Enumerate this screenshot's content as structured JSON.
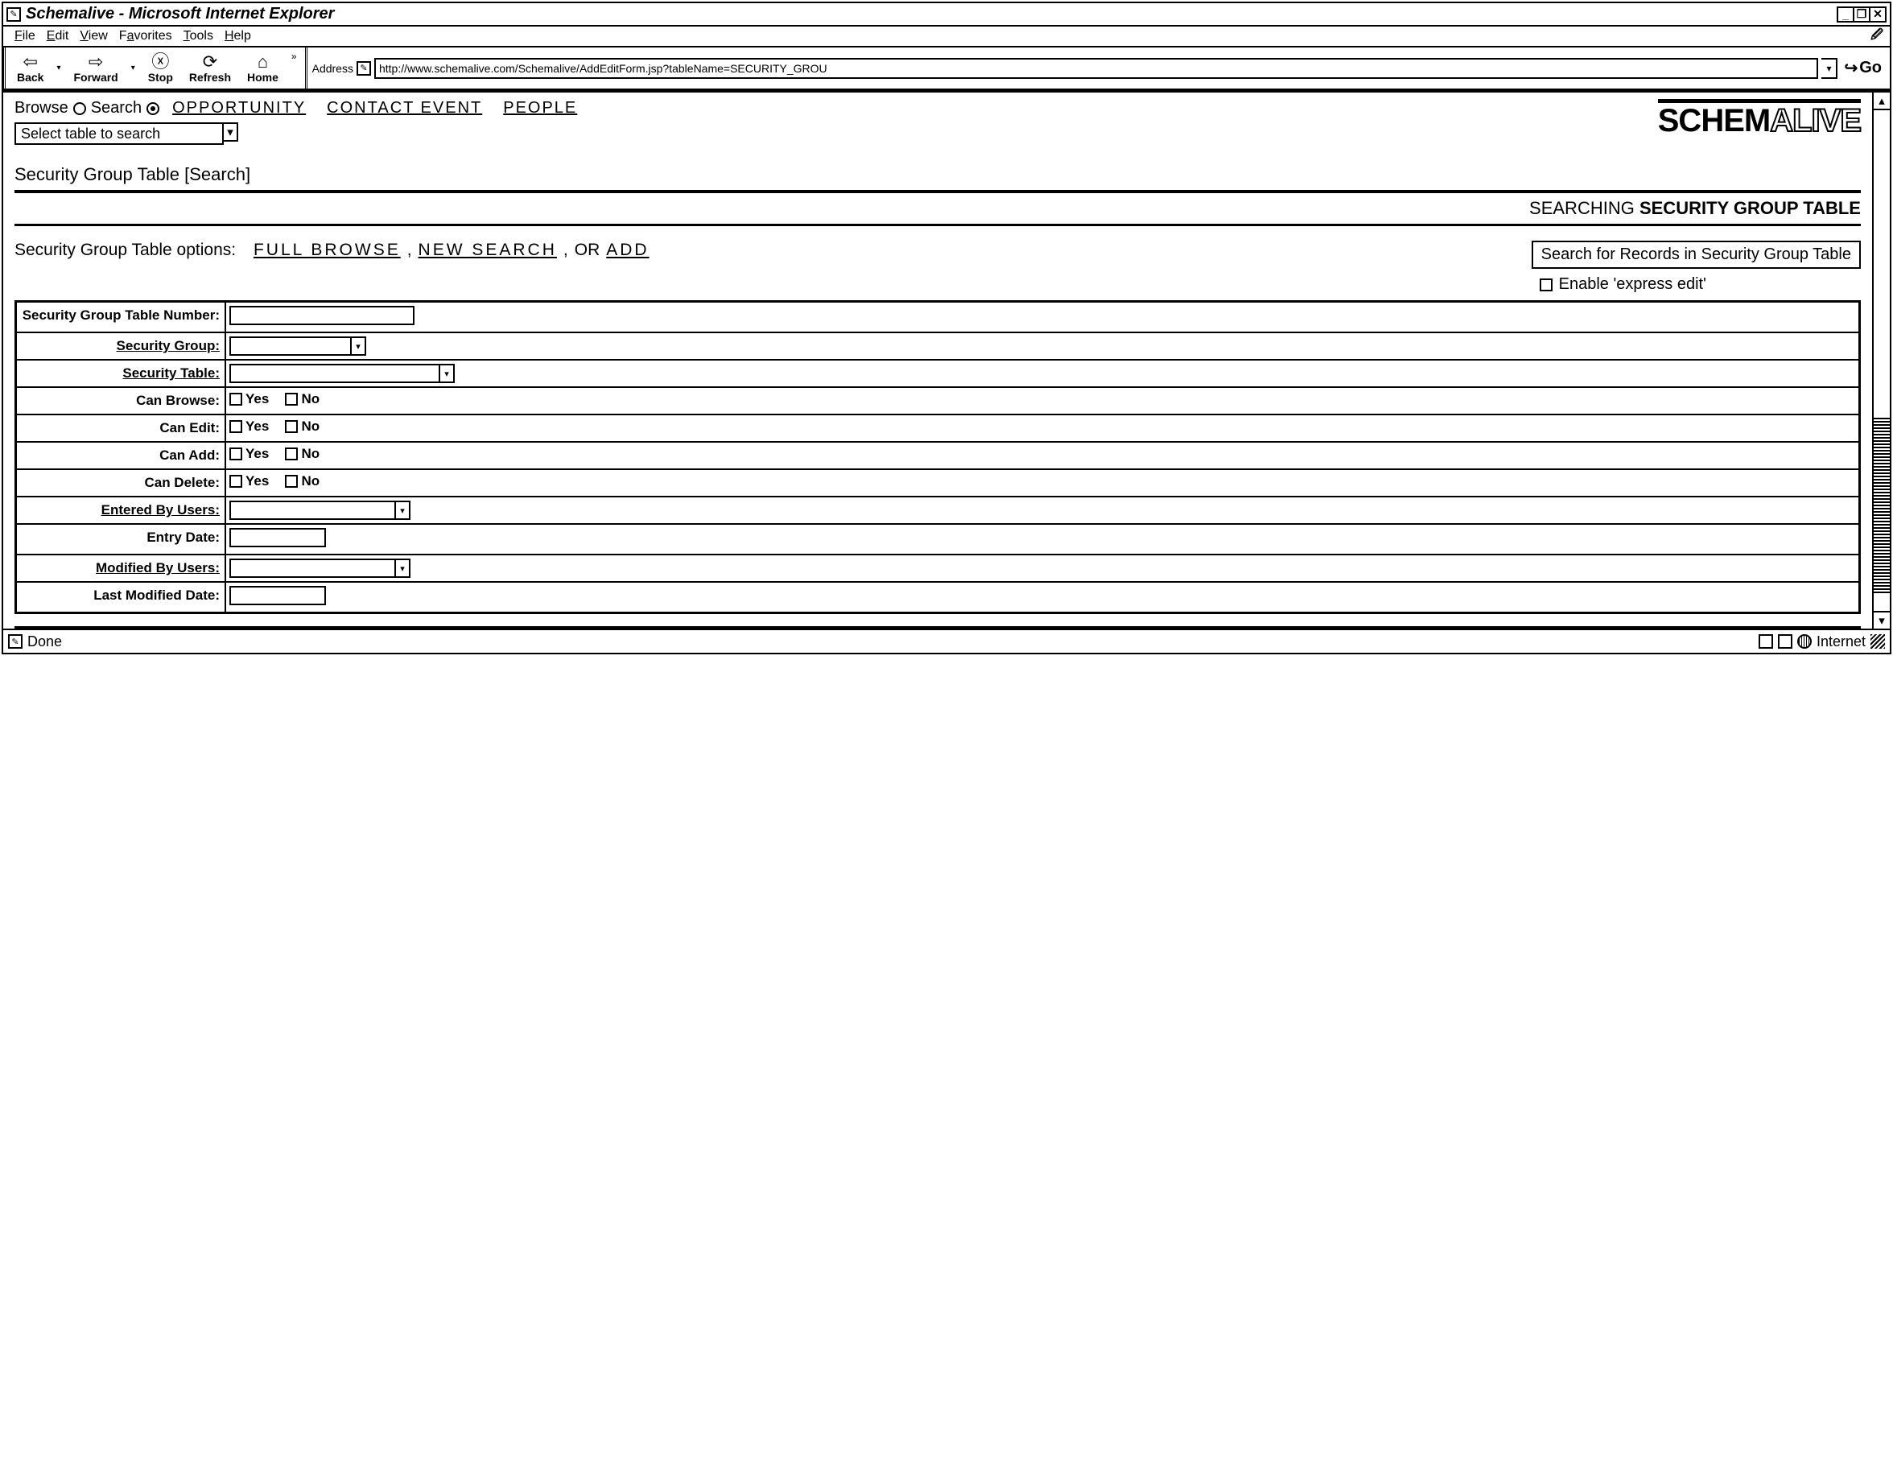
{
  "window": {
    "title": "Schemalive - Microsoft Internet Explorer"
  },
  "menu": {
    "file": "File",
    "edit": "Edit",
    "view": "View",
    "favorites": "Favorites",
    "tools": "Tools",
    "help": "Help"
  },
  "toolbar": {
    "back": "Back",
    "forward": "Forward",
    "stop": "Stop",
    "refresh": "Refresh",
    "home": "Home",
    "address_label": "Address",
    "address_value": "http://www.schemalive.com/Schemalive/AddEditForm.jsp?tableName=SECURITY_GROU",
    "go": "Go"
  },
  "topnav": {
    "browse_label": "Browse",
    "search_label": "Search",
    "link_opportunity": "OPPORTUNITY",
    "link_contact_event": "CONTACT  EVENT",
    "link_people": "PEOPLE",
    "select_placeholder": "Select table to search",
    "logo_main": "SCHEM",
    "logo_tail": "ALIVE"
  },
  "page": {
    "title": "Security Group Table [Search]",
    "subhead_prefix": "SEARCHING ",
    "subhead_bold": "SECURITY GROUP TABLE",
    "options_label": "Security Group Table options:",
    "opt_full_browse": "FULL  BROWSE",
    "opt_new_search": "NEW  SEARCH",
    "opt_or": " OR ",
    "opt_add": "ADD",
    "search_button": "Search for Records in Security Group Table",
    "enable_express": "Enable 'express edit'"
  },
  "form": {
    "fields": {
      "number": "Security Group Table Number:",
      "group": "Security Group:",
      "table": "Security Table:",
      "can_browse": "Can Browse:",
      "can_edit": "Can Edit:",
      "can_add": "Can Add:",
      "can_delete": "Can Delete:",
      "entered_by": "Entered By Users:",
      "entry_date": "Entry Date:",
      "modified_by": "Modified By Users:",
      "last_modified": "Last Modified Date:"
    },
    "yes": "Yes",
    "no": "No"
  },
  "status": {
    "left": "Done",
    "zone": "Internet"
  }
}
